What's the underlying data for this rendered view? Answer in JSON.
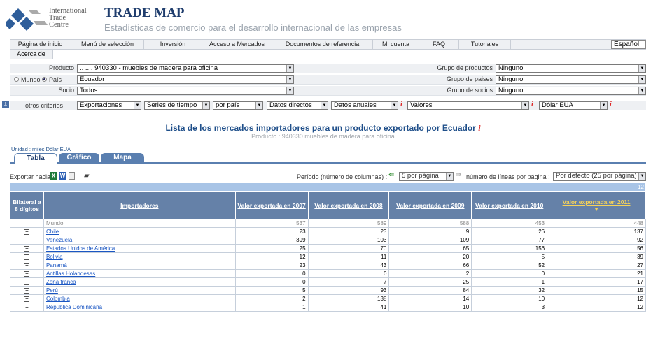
{
  "header": {
    "org_line1": "International",
    "org_line2": "Trade",
    "org_line3": "Centre",
    "title": "TRADE MAP",
    "subtitle": "Estadísticas de comercio para el desarrollo internacional de las empresas",
    "language": "Español"
  },
  "menu": [
    "Página de inicio",
    "Menú de selección",
    "Inversión",
    "Acceso a Mercados",
    "Documentos de referencia",
    "Mi cuenta",
    "FAQ",
    "Tutoriales"
  ],
  "menu2": "Acerca de",
  "criteria": {
    "producto_label": "Producto",
    "producto_value": ".. .... 940330 - muebles de madera para oficina",
    "mundo_label": "Mundo",
    "pais_label": "País",
    "pais_value": "Ecuador",
    "socio_label": "Socio",
    "socio_value": "Todos",
    "grupo_productos_label": "Grupo de productos",
    "grupo_productos_value": "Ninguno",
    "grupo_paises_label": "Grupo de paises",
    "grupo_paises_value": "Ninguno",
    "grupo_socios_label": "Grupo de socios",
    "grupo_socios_value": "Ninguno",
    "otros_label": "otros criterios",
    "flow": "Exportaciones",
    "series": "Series de tiempo",
    "por": "por país",
    "datos": "Datos directos",
    "anuales": "Datos anuales",
    "valores": "Valores",
    "moneda": "Dólar EUA"
  },
  "main": {
    "title": "Lista de los mercados importadores para un producto exportado por Ecuador",
    "subtitle": "Producto : 940330 muebles de madera para oficina",
    "unit": "Unidad : miles Dólar EUA"
  },
  "tabs": [
    "Tabla",
    "Gráfico",
    "Mapa"
  ],
  "toolbar": {
    "export_label": "Exportar hacia",
    "periodo_label": "Período (número de columnas) :",
    "periodo_value": "5 por página",
    "lineas_label": "número de líneas por página :",
    "lineas_value": "Por defecto (25 por página)"
  },
  "table": {
    "band_text": "12",
    "col_bilateral": "Bilateral a 8 dígitos",
    "col_importadores": "Importadores",
    "years": [
      "Valor exportada en 2007",
      "Valor exportada en 2008",
      "Valor exportada en 2009",
      "Valor exportada en 2010",
      "Valor exportada en 2011"
    ],
    "rows": [
      {
        "name": "Mundo",
        "v": [
          "537",
          "589",
          "588",
          "453",
          "448"
        ]
      },
      {
        "name": "Chile",
        "v": [
          "23",
          "23",
          "9",
          "26",
          "137"
        ]
      },
      {
        "name": "Venezuela",
        "v": [
          "399",
          "103",
          "109",
          "77",
          "92"
        ]
      },
      {
        "name": "Estados Unidos de América",
        "v": [
          "25",
          "70",
          "65",
          "156",
          "56"
        ]
      },
      {
        "name": "Bolivia",
        "v": [
          "12",
          "11",
          "20",
          "5",
          "39"
        ]
      },
      {
        "name": "Panamá",
        "v": [
          "23",
          "43",
          "66",
          "52",
          "27"
        ]
      },
      {
        "name": "Antillas Holandesas",
        "v": [
          "0",
          "0",
          "2",
          "0",
          "21"
        ]
      },
      {
        "name": "Zona franca",
        "v": [
          "0",
          "7",
          "25",
          "1",
          "17"
        ]
      },
      {
        "name": "Perú",
        "v": [
          "5",
          "93",
          "84",
          "32",
          "15"
        ]
      },
      {
        "name": "Colombia",
        "v": [
          "2",
          "138",
          "14",
          "10",
          "12"
        ]
      },
      {
        "name": "República Dominicana",
        "v": [
          "1",
          "41",
          "10",
          "3",
          "12"
        ]
      }
    ]
  }
}
